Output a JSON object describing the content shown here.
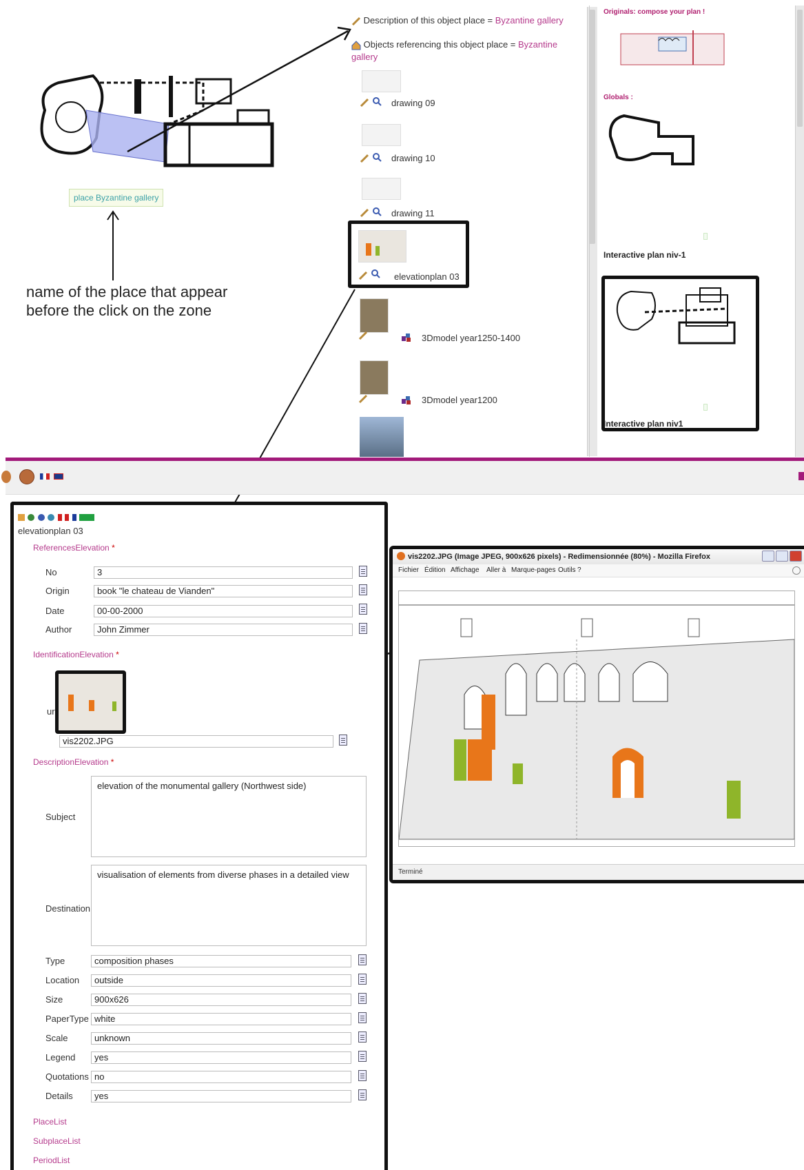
{
  "top_left": {
    "place_label": "place Byzantine gallery",
    "caption_line1": "name of the place that appear",
    "caption_line2": "before the click on the zone"
  },
  "object_list": {
    "description_prefix": "Description of this object place = ",
    "description_value": "Byzantine gallery",
    "referencing_prefix": "Objects referencing this object place = ",
    "referencing_value": "Byzantine gallery",
    "items": [
      {
        "label": "drawing 09"
      },
      {
        "label": "drawing 10"
      },
      {
        "label": "drawing 11"
      },
      {
        "label": "elevationplan 03"
      },
      {
        "label": "3Dmodel year1250-1400"
      },
      {
        "label": "3Dmodel year1200"
      }
    ]
  },
  "right_panel": {
    "originals_head": "Originals: compose your plan !",
    "globals_head": "Globals :",
    "plan1_label": "Interactive plan niv-1",
    "plan2_label": "Interactive plan niv1"
  },
  "form": {
    "title": "elevationplan 03",
    "sections": {
      "references": "ReferencesElevation",
      "identification": "IdentificationElevation",
      "description": "DescriptionElevation",
      "required_mark": "*"
    },
    "fields": {
      "no": {
        "label": "No",
        "value": "3"
      },
      "origin": {
        "label": "Origin",
        "value": "book \"le chateau de Vianden\""
      },
      "date": {
        "label": "Date",
        "value": "00-00-2000"
      },
      "author": {
        "label": "Author",
        "value": "John Zimmer"
      },
      "url": {
        "label": "url",
        "value": "vis2202.JPG"
      },
      "subject": {
        "label": "Subject",
        "value": "elevation of the monumental gallery (Northwest side)"
      },
      "destination": {
        "label": "Destination",
        "value": "visualisation of elements from diverse phases in a detailed view"
      },
      "type": {
        "label": "Type",
        "value": "composition phases"
      },
      "location": {
        "label": "Location",
        "value": "outside"
      },
      "size": {
        "label": "Size",
        "value": "900x626"
      },
      "papertype": {
        "label": "PaperType",
        "value": "white"
      },
      "scale": {
        "label": "Scale",
        "value": "unknown"
      },
      "legend": {
        "label": "Legend",
        "value": "yes"
      },
      "quotations": {
        "label": "Quotations",
        "value": "no"
      },
      "details": {
        "label": "Details",
        "value": "yes"
      }
    },
    "links": [
      "PlaceList",
      "SubplaceList",
      "PeriodList"
    ]
  },
  "firefox": {
    "title": "vis2202.JPG (Image JPEG, 900x626 pixels) - Redimensionnée (80%) - Mozilla Firefox",
    "menu": [
      "Fichier",
      "Édition",
      "Affichage",
      "Aller à",
      "Marque-pages",
      "Outils",
      "?"
    ],
    "status": "Terminé"
  },
  "colors": {
    "accent_magenta": "#a21a7a",
    "link_pink": "#b53a8c",
    "phase_orange": "#e8761a",
    "phase_green": "#8fb52a"
  }
}
